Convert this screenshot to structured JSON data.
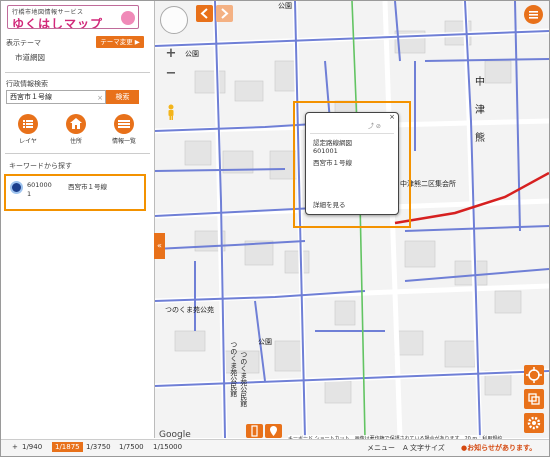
{
  "sidebar": {
    "logo_small": "行橋市地図情報サービス",
    "logo_big": "ゆくはしマップ",
    "theme_heading": "表示テーマ",
    "theme_button": "テーマ変更 ▶",
    "theme_value": "市道網図",
    "search_heading": "行政情報検索",
    "search_value": "西宮市１号線",
    "search_clear": "×",
    "search_button": "検索",
    "tools": [
      {
        "label": "レイヤ",
        "icon": "list-icon"
      },
      {
        "label": "住所",
        "icon": "house-icon"
      },
      {
        "label": "情報一覧",
        "icon": "table-icon"
      }
    ],
    "keyword_heading": "キーワードから探す",
    "result": {
      "code": "601000",
      "name": "西宮市１号線",
      "line2": "1"
    }
  },
  "map": {
    "toggle_label": "«",
    "zoom_in": "+",
    "zoom_out": "−",
    "labels": {
      "park1": "公園",
      "park2": "公園",
      "park3": "公園",
      "tsunokuma": "つのくま苑公苑",
      "community": "つのくま苑公民館",
      "community2": "つのくま苑公民館",
      "hall": "中津熊二区集会所",
      "naka": "中",
      "tsu": "津",
      "kuma": "熊"
    },
    "popup": {
      "title": "認定路線網図",
      "code": "601001",
      "name": "西宮市１号線",
      "link": "詳細を見る",
      "close": "×"
    },
    "google": "Google",
    "attribution": "キーボード ショートカット　画像は著作権で保護されている場合があります　20 m　利用規約"
  },
  "bottom": {
    "scales": [
      "1/940",
      "1/1875",
      "1/3750",
      "1/7500",
      "1/15000"
    ],
    "active_scale": "1/1875",
    "nav_prev": "+",
    "menu_label": "メニュー",
    "text_size": "A 文字サイズ",
    "notice": "●お知らせがあります。"
  },
  "colors": {
    "accent": "#e8711a",
    "highlight": "#f39200",
    "road_blue": "#6f7fd6",
    "road_red": "#d62020",
    "road_green": "#62c462"
  }
}
